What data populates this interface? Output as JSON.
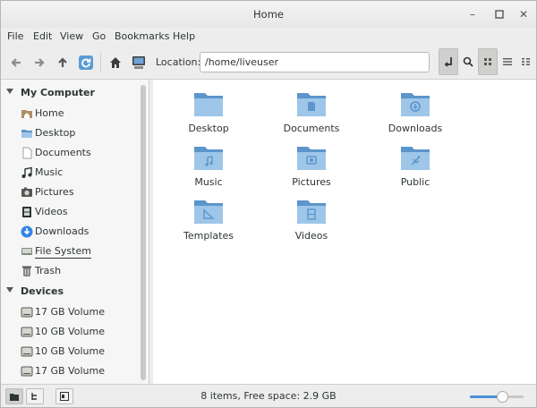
{
  "window": {
    "title": "Home"
  },
  "menu": [
    "File",
    "Edit",
    "View",
    "Go",
    "Bookmarks",
    "Help"
  ],
  "toolbar": {
    "location_label": "Location:",
    "location_value": "/home/liveuser"
  },
  "sidebar": {
    "my_computer": {
      "label": "My Computer",
      "items": [
        {
          "label": "Home",
          "icon": "home-folder-icon"
        },
        {
          "label": "Desktop",
          "icon": "desktop-folder-icon"
        },
        {
          "label": "Documents",
          "icon": "documents-icon"
        },
        {
          "label": "Music",
          "icon": "music-icon"
        },
        {
          "label": "Pictures",
          "icon": "pictures-icon"
        },
        {
          "label": "Videos",
          "icon": "videos-icon"
        },
        {
          "label": "Downloads",
          "icon": "downloads-icon"
        },
        {
          "label": "File System",
          "icon": "harddisk-icon",
          "selected": true
        },
        {
          "label": "Trash",
          "icon": "trash-icon"
        }
      ]
    },
    "devices": {
      "label": "Devices",
      "items": [
        {
          "label": "17 GB Volume",
          "icon": "drive-icon"
        },
        {
          "label": "10 GB Volume",
          "icon": "drive-icon"
        },
        {
          "label": "10 GB Volume",
          "icon": "drive-icon"
        },
        {
          "label": "17 GB Volume",
          "icon": "drive-icon"
        }
      ]
    }
  },
  "files": [
    {
      "label": "Desktop",
      "emblem": "none"
    },
    {
      "label": "Documents",
      "emblem": "document"
    },
    {
      "label": "Downloads",
      "emblem": "download"
    },
    {
      "label": "Music",
      "emblem": "music"
    },
    {
      "label": "Pictures",
      "emblem": "picture"
    },
    {
      "label": "Public",
      "emblem": "share"
    },
    {
      "label": "Templates",
      "emblem": "template"
    },
    {
      "label": "Videos",
      "emblem": "video"
    }
  ],
  "status": {
    "text": "8 items, Free space: 2.9 GB",
    "zoom_level": 0.6
  },
  "colors": {
    "folder_light": "#9ec6e8",
    "folder_dark": "#5b95cc",
    "accent": "#4a90d9"
  }
}
